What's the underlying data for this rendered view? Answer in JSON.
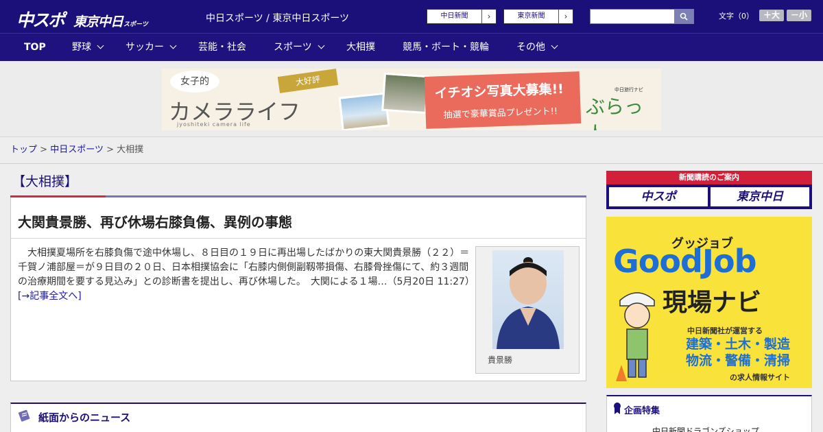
{
  "header": {
    "logo_chuspo": "中スポ",
    "logo_tokyo": "東京中日",
    "logo_sports": "スポーツ",
    "site_name": "中日スポーツ / 東京中日スポーツ",
    "paper_buttons": [
      "中日新聞",
      "東京新聞"
    ],
    "search_placeholder": "",
    "font_size_label": "文字（0）",
    "font_bigger": "＋大",
    "font_smaller": "－小"
  },
  "nav": {
    "items": [
      "TOP",
      "野球",
      "サッカー",
      "芸能・社会",
      "スポーツ",
      "大相撲",
      "競馬・ボート・競輪",
      "その他"
    ]
  },
  "banner": {
    "bubble": "女子的",
    "title": "カメラライフ",
    "subtitle": "jyoshiteki camera life",
    "tag": "大好評",
    "headline": "イチオシ写真大募集!!",
    "sub_headline": "抽選で豪華賞品プレゼント!!",
    "brand": "ぶらっ人",
    "brand_small": "中日旅行ナビ"
  },
  "breadcrumb": {
    "home": "トップ",
    "parent": "中日スポーツ",
    "current": "大相撲",
    "separator": ">"
  },
  "main": {
    "category": "【大相撲】",
    "article": {
      "title": "大関貴景勝、再び休場右膝負傷、異例の事態",
      "body": "　大相撲夏場所を右膝負傷で途中休場し、８日目の１９日に再出場したばかりの東大関貴景勝（２２）＝千賀ノ浦部屋＝が９日目の２０日、日本相撲協会に「右膝内側側副靱帯損傷、右膝骨挫傷にて、約３週間の治療期間を要する見込み」との診断書を提出し、再び休場した。　大関による１場…（5月20日 11:27）　",
      "more_link": "[→記事全文へ]",
      "photo_caption": "貴景勝"
    },
    "news_section_title": "紙面からのニュース"
  },
  "sidebar": {
    "subscribe_head": "新聞購読のご案内",
    "subscribe_buttons": [
      "中スポ",
      "東京中日"
    ],
    "ad_goodjob": {
      "catch": "グッジョブ",
      "title": "GoodJob",
      "subtitle": "現場ナビ",
      "operator": "中日新聞社が運営する",
      "fields": "建築・土木・製造 物流・警備・清掃",
      "tagline": "の求人情報サイト"
    },
    "special_title": "企画特集",
    "special_item": "中日新聞ドラゴンズショップ"
  },
  "colors": {
    "header_bg": "#1b0f7a",
    "accent_red": "#d22840",
    "link": "#1b18a4"
  }
}
